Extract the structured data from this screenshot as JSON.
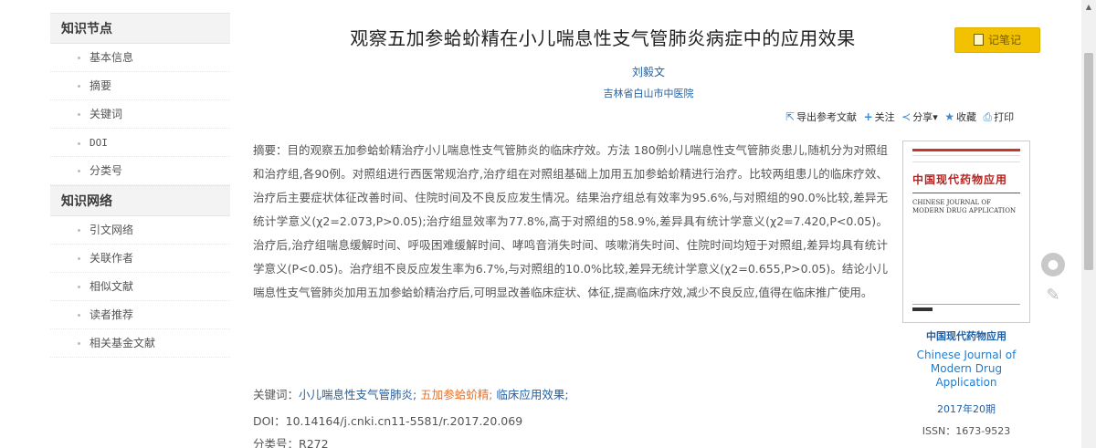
{
  "sidebar": {
    "section1": "知识节点",
    "items1": [
      "基本信息",
      "摘要",
      "关键词",
      "DOI",
      "分类号"
    ],
    "section2": "知识网络",
    "items2": [
      "引文网络",
      "关联作者",
      "相似文献",
      "读者推荐",
      "相关基金文献"
    ]
  },
  "article": {
    "title": "观察五加参蛤蚧精在小儿喘息性支气管肺炎病症中的应用效果",
    "note_button": "记笔记",
    "author": "刘毅文",
    "organization": "吉林省白山市中医院"
  },
  "actions": {
    "export": "导出参考文献",
    "follow": "关注",
    "share": "分享",
    "collect": "收藏",
    "print": "打印"
  },
  "abstract": {
    "text": "摘要：目的观察五加参蛤蚧精治疗小儿喘息性支气管肺炎的临床疗效。方法 180例小儿喘息性支气管肺炎患儿,随机分为对照组和治疗组,各90例。对照组进行西医常规治疗,治疗组在对照组基础上加用五加参蛤蚧精进行治疗。比较两组患儿的临床疗效、治疗后主要症状体征改善时间、住院时间及不良反应发生情况。结果治疗组总有效率为95.6%,与对照组的90.0%比较,差异无统计学意义(χ2=2.073,P>0.05);治疗组显效率为77.8%,高于对照组的58.9%,差异具有统计学意义(χ2=7.420,P<0.05)。治疗后,治疗组喘息缓解时间、呼吸困难缓解时间、哮鸣音消失时间、咳嗽消失时间、住院时间均短于对照组,差异均具有统计学意义(P<0.05)。治疗组不良反应发生率为6.7%,与对照组的10.0%比较,差异无统计学意义(χ2=0.655,P>0.05)。结论小儿喘息性支气管肺炎加用五加参蛤蚧精治疗后,可明显改善临床症状、体征,提高临床疗效,减少不良反应,值得在临床推广使用。"
  },
  "keywords": {
    "label": "关键词：",
    "items": [
      "小儿喘息性支气管肺炎;",
      "五加参蛤蚧精;",
      "临床应用效果;"
    ]
  },
  "doi": {
    "label": "DOI：",
    "value": "10.14164/j.cnki.cn11-5581/r.2017.20.069"
  },
  "classification": {
    "label": "分类号：",
    "value": "R272"
  },
  "journal": {
    "cover_cn": "中国现代药物应用",
    "cover_en": "CHINESE JOURNAL OF MODERN DRUG APPLICATION",
    "name_cn": "中国现代药物应用",
    "name_en": "Chinese Journal of Modern Drug Application",
    "issue": "2017年20期",
    "issn": "ISSN：1673-9523"
  },
  "colors": {
    "link": "#1f5fa6",
    "highlight_keyword": "#e8712a",
    "note_button": "#f2c200"
  }
}
